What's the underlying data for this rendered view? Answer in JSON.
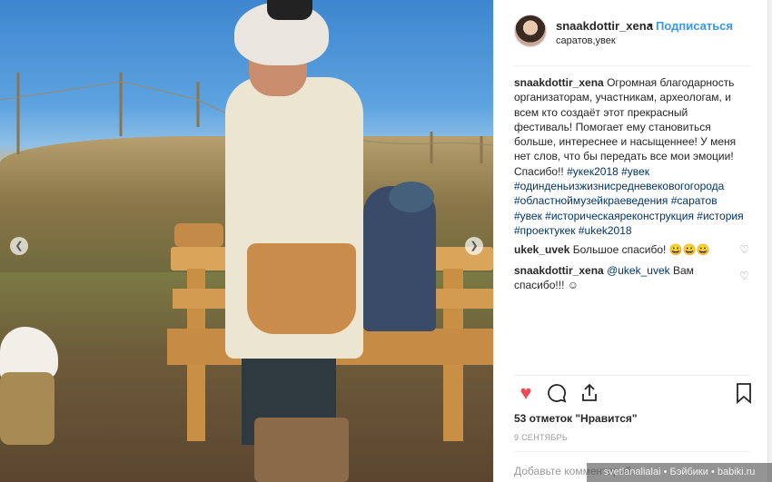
{
  "post": {
    "username": "snaakdottir_xena",
    "follow_label": "Подписаться",
    "location": "саратов,увек"
  },
  "comments": [
    {
      "user": "snaakdottir_xena",
      "text": "Огромная благодарность организаторам, участникам, археологам, и всем кто создаёт этот прекрасный фестиваль! Помогает ему становиться больше, интереснее и насыщеннее! У меня нет слов, что бы передать все мои эмоции! Спасибо!!",
      "hashtags": "#укек2018 #увек #одинденьизжизнисредневековогогорода #областноймузейкраеведения #саратов #увек #историческаяреконструкция #история #проектукек #ukek2018"
    },
    {
      "user": "ukek_uvek",
      "text": "Большое спасибо! 😀😀😀"
    },
    {
      "user": "snaakdottir_xena",
      "mention": "@ukek_uvek",
      "text": "Вам спасибо!!! ☺"
    }
  ],
  "likes_text": "53 отметок \"Нравится\"",
  "date": "9 СЕНТЯБРЬ",
  "add_comment_placeholder": "Добавьте комментарий...",
  "watermark": "svetlanalialai • Бэйбики • babiki.ru",
  "icons": {
    "like": "heart-icon",
    "comment": "comment-icon",
    "share": "share-icon",
    "save": "bookmark-icon"
  },
  "colors": {
    "link": "#3897f0",
    "hashtag": "#003569",
    "like_active": "#ed4956"
  }
}
